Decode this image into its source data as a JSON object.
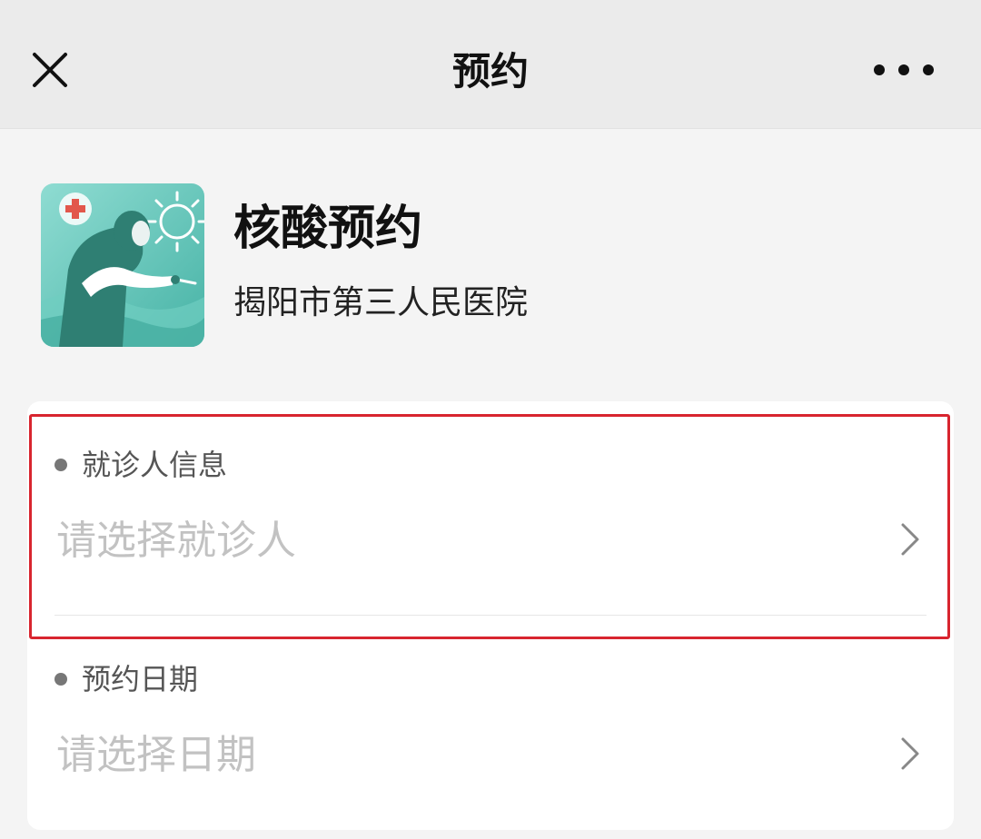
{
  "navbar": {
    "title": "预约",
    "close_icon": "close-icon",
    "more_icon": "more-icon"
  },
  "service": {
    "name": "核酸预约",
    "organization": "揭阳市第三人民医院",
    "logo_icon": "nucleic-test-logo"
  },
  "form": {
    "patient": {
      "label": "就诊人信息",
      "placeholder": "请选择就诊人"
    },
    "date": {
      "label": "预约日期",
      "placeholder": "请选择日期"
    }
  },
  "colors": {
    "highlight": "#d8252f",
    "logo_teal": "#5fc4b8",
    "placeholder": "#c2c2c2"
  }
}
